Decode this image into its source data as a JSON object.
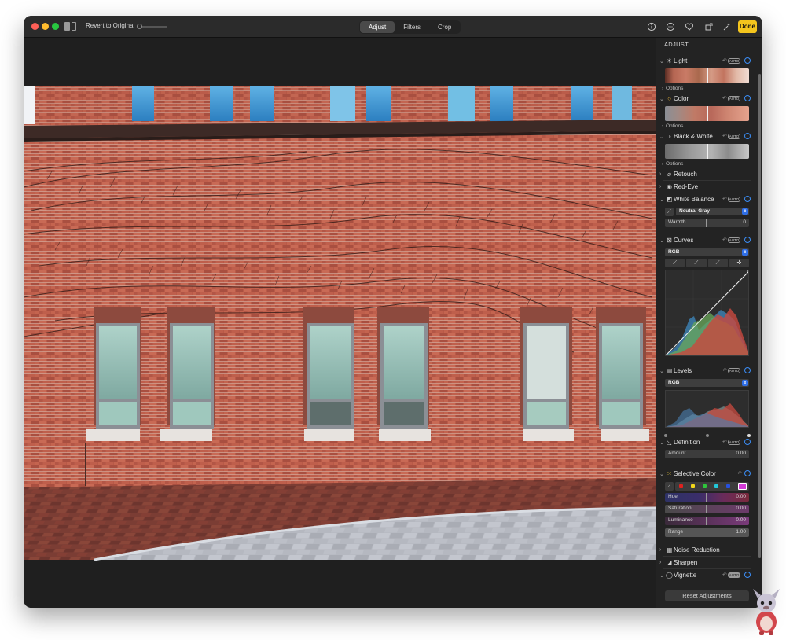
{
  "toolbar": {
    "revert_label": "Revert to Original",
    "tabs": [
      {
        "label": "Adjust",
        "active": true
      },
      {
        "label": "Filters",
        "active": false
      },
      {
        "label": "Crop",
        "active": false
      }
    ],
    "done_label": "Done",
    "icons": [
      "info-icon",
      "more-icon",
      "heart-icon",
      "rotate-icon",
      "auto-enhance-icon"
    ]
  },
  "colors": {
    "accent": "#3b8df5",
    "done": "#f4c51d",
    "close": "#fe5f57",
    "minimize": "#febc2e",
    "zoom": "#28c840"
  },
  "panel": {
    "title": "ADJUST",
    "light": {
      "label": "Light",
      "auto": "AUTO",
      "options": "Options"
    },
    "color": {
      "label": "Color",
      "auto": "AUTO",
      "options": "Options"
    },
    "bw": {
      "label": "Black & White",
      "auto": "AUTO",
      "options": "Options"
    },
    "retouch": {
      "label": "Retouch"
    },
    "redeye": {
      "label": "Red-Eye"
    },
    "white_balance": {
      "label": "White Balance",
      "auto": "AUTO",
      "mode": "Neutral Gray",
      "warmth_label": "Warmth",
      "warmth_value": "0"
    },
    "curves": {
      "label": "Curves",
      "auto": "AUTO",
      "channel": "RGB"
    },
    "levels": {
      "label": "Levels",
      "auto": "AUTO",
      "channel": "RGB"
    },
    "definition": {
      "label": "Definition",
      "auto": "AUTO",
      "amount_label": "Amount",
      "amount_value": "0.00"
    },
    "selective_color": {
      "label": "Selective Color",
      "swatches": [
        "#e0211e",
        "#f2d71a",
        "#2ec53b",
        "#22c7d8",
        "#2651e0",
        "#d23ad6"
      ],
      "hue_label": "Hue",
      "hue_value": "0.00",
      "saturation_label": "Saturation",
      "saturation_value": "0.00",
      "luminance_label": "Luminance",
      "luminance_value": "0.00",
      "range_label": "Range",
      "range_value": "1.00"
    },
    "noise": {
      "label": "Noise Reduction"
    },
    "sharpen": {
      "label": "Sharpen"
    },
    "vignette": {
      "label": "Vignette",
      "auto": "AUTO"
    },
    "reset_label": "Reset Adjustments"
  }
}
